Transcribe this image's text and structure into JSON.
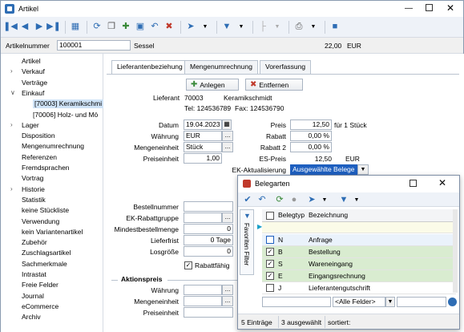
{
  "window": {
    "title": "Artikel"
  },
  "header": {
    "artno_label": "Artikelnummer",
    "artno_value": "100001",
    "name": "Sessel",
    "price": "22,00",
    "currency": "EUR"
  },
  "tree": {
    "items": [
      {
        "label": "Artikel",
        "chev": ""
      },
      {
        "label": "Verkauf",
        "chev": ">"
      },
      {
        "label": "Verträge",
        "chev": ""
      },
      {
        "label": "Einkauf",
        "chev": "v"
      },
      {
        "label": "[70003]  Keramikschmi",
        "chev": "",
        "sub": true,
        "sel": true
      },
      {
        "label": "[70006]  Holz- und Mö",
        "chev": "",
        "sub": true
      },
      {
        "label": "Lager",
        "chev": ">"
      },
      {
        "label": "Disposition",
        "chev": ""
      },
      {
        "label": "Mengenumrechnung",
        "chev": ""
      },
      {
        "label": "Referenzen",
        "chev": ""
      },
      {
        "label": "Fremdsprachen",
        "chev": ""
      },
      {
        "label": "Vortrag",
        "chev": ""
      },
      {
        "label": "Historie",
        "chev": ">"
      },
      {
        "label": "Statistik",
        "chev": ""
      },
      {
        "label": "keine Stückliste",
        "chev": ""
      },
      {
        "label": "Verwendung",
        "chev": ""
      },
      {
        "label": "kein Variantenartikel",
        "chev": ""
      },
      {
        "label": "Zubehör",
        "chev": ""
      },
      {
        "label": "Zuschlagsartikel",
        "chev": ""
      },
      {
        "label": "Sachmerkmale",
        "chev": ""
      },
      {
        "label": "Intrastat",
        "chev": ""
      },
      {
        "label": "Freie Felder",
        "chev": ""
      },
      {
        "label": "Journal",
        "chev": ""
      },
      {
        "label": "eCommerce",
        "chev": ""
      },
      {
        "label": "Archiv",
        "chev": ""
      }
    ]
  },
  "tabs": [
    "Lieferantenbeziehung",
    "Mengenumrechnung",
    "Vorerfassung"
  ],
  "buttons": {
    "add": "Anlegen",
    "remove": "Entfernen"
  },
  "supplier": {
    "label": "Lieferant",
    "number": "70003",
    "name": "Keramikschmidt",
    "tel": "Tel: 124536789",
    "fax": "Fax: 124536790"
  },
  "form": {
    "datum_l": "Datum",
    "datum": "19.04.2023",
    "waehrung_l": "Währung",
    "waehrung": "EUR",
    "me_l": "Mengeneinheit",
    "me": "Stück",
    "pe_l": "Preiseinheit",
    "pe": "1,00",
    "preis_l": "Preis",
    "preis": "12,50",
    "preis_suffix": "für 1 Stück",
    "rabatt_l": "Rabatt",
    "rabatt": "0,00 %",
    "rabatt2_l": "Rabatt 2",
    "rabatt2": "0,00 %",
    "espreis_l": "ES-Preis",
    "espreis": "12,50",
    "espreis_cur": "EUR",
    "ekakt_l": "EK-Aktualisierung",
    "ekakt": "Ausgewählte Belege",
    "bestnr_l": "Bestellnummer",
    "ekrg_l": "EK-Rabattgruppe",
    "minbest_l": "Mindestbestellmenge",
    "minbest": "0",
    "lieferfrist_l": "Lieferfrist",
    "lieferfrist": "0 Tage",
    "losgroesse_l": "Losgröße",
    "losgroesse": "0",
    "rabattfaehig": "Rabattfähig"
  },
  "aktion": {
    "title": "Aktionspreis",
    "waehrung_l": "Währung",
    "me_l": "Mengeneinheit",
    "pe_l": "Preiseinheit"
  },
  "popup": {
    "title": "Belegarten",
    "side_label": "Favoriten Filter",
    "col1": "Belegtyp",
    "col2": "Bezeichnung",
    "rows": [
      {
        "typ": "N",
        "bez": "Anfrage",
        "checked": false,
        "sel": false,
        "cur": true
      },
      {
        "typ": "B",
        "bez": "Bestellung",
        "checked": true,
        "sel": true
      },
      {
        "typ": "S",
        "bez": "Wareneingang",
        "checked": true,
        "sel": true
      },
      {
        "typ": "E",
        "bez": "Eingangsrechnung",
        "checked": true,
        "sel": true
      },
      {
        "typ": "J",
        "bez": "Lieferantengutschrift",
        "checked": false,
        "sel": false
      }
    ],
    "filter_select": "<Alle Felder>",
    "status": [
      "5 Einträge",
      "3 ausgewählt",
      "sortiert:"
    ]
  }
}
